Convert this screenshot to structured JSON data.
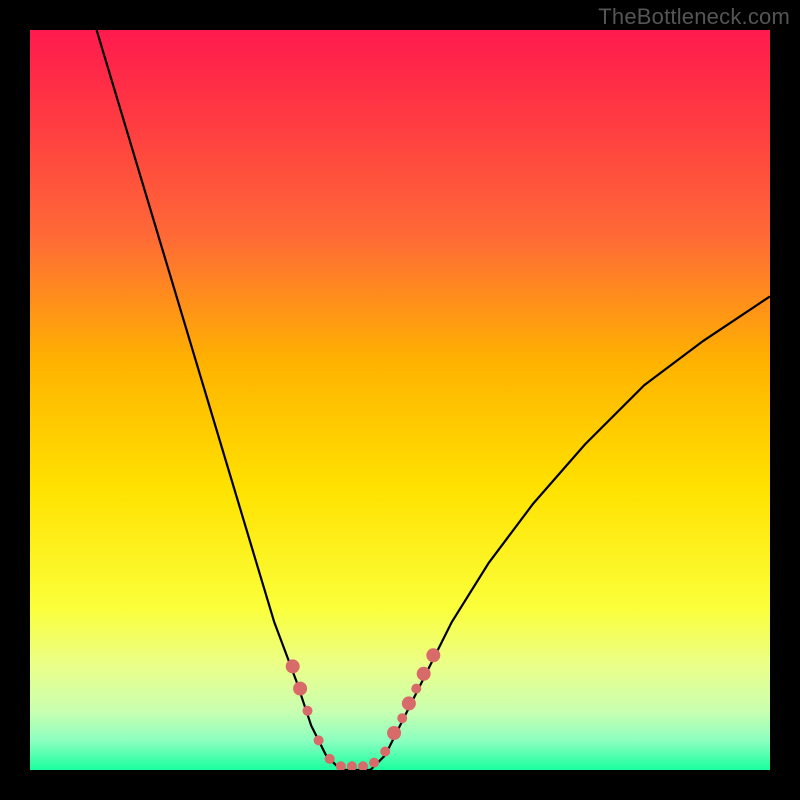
{
  "watermark": "TheBottleneck.com",
  "chart_data": {
    "type": "line",
    "title": "",
    "xlabel": "",
    "ylabel": "",
    "xlim": [
      0,
      100
    ],
    "ylim": [
      0,
      100
    ],
    "background_gradient": {
      "stops": [
        {
          "t": 0.0,
          "color": "#ff1a4d"
        },
        {
          "t": 0.12,
          "color": "#ff3a42"
        },
        {
          "t": 0.28,
          "color": "#ff6a36"
        },
        {
          "t": 0.45,
          "color": "#ffb300"
        },
        {
          "t": 0.62,
          "color": "#ffe200"
        },
        {
          "t": 0.78,
          "color": "#fbff3a"
        },
        {
          "t": 0.86,
          "color": "#eaff8a"
        },
        {
          "t": 0.92,
          "color": "#c9ffb0"
        },
        {
          "t": 0.96,
          "color": "#8dffc0"
        },
        {
          "t": 1.0,
          "color": "#19ff9e"
        }
      ]
    },
    "series": [
      {
        "name": "curve",
        "color": "#000000",
        "points": [
          {
            "x": 9,
            "y": 100
          },
          {
            "x": 12,
            "y": 90
          },
          {
            "x": 15,
            "y": 80
          },
          {
            "x": 18,
            "y": 70
          },
          {
            "x": 21,
            "y": 60
          },
          {
            "x": 24,
            "y": 50
          },
          {
            "x": 27,
            "y": 40
          },
          {
            "x": 30,
            "y": 30
          },
          {
            "x": 33,
            "y": 20
          },
          {
            "x": 36,
            "y": 12
          },
          {
            "x": 38,
            "y": 6
          },
          {
            "x": 40,
            "y": 2
          },
          {
            "x": 42,
            "y": 0
          },
          {
            "x": 44,
            "y": 0
          },
          {
            "x": 46,
            "y": 0
          },
          {
            "x": 48,
            "y": 2
          },
          {
            "x": 50,
            "y": 6
          },
          {
            "x": 53,
            "y": 12
          },
          {
            "x": 57,
            "y": 20
          },
          {
            "x": 62,
            "y": 28
          },
          {
            "x": 68,
            "y": 36
          },
          {
            "x": 75,
            "y": 44
          },
          {
            "x": 83,
            "y": 52
          },
          {
            "x": 91,
            "y": 58
          },
          {
            "x": 100,
            "y": 64
          }
        ]
      }
    ],
    "markers": {
      "color": "#d86a6a",
      "radius_large": 7,
      "radius_small": 5,
      "points": [
        {
          "x": 35.5,
          "y": 14,
          "r": "large"
        },
        {
          "x": 36.5,
          "y": 11,
          "r": "large"
        },
        {
          "x": 37.5,
          "y": 8,
          "r": "small"
        },
        {
          "x": 39,
          "y": 4,
          "r": "small"
        },
        {
          "x": 40.5,
          "y": 1.5,
          "r": "small"
        },
        {
          "x": 42,
          "y": 0.5,
          "r": "small"
        },
        {
          "x": 43.5,
          "y": 0.5,
          "r": "small"
        },
        {
          "x": 45,
          "y": 0.5,
          "r": "small"
        },
        {
          "x": 46.5,
          "y": 1,
          "r": "small"
        },
        {
          "x": 48,
          "y": 2.5,
          "r": "small"
        },
        {
          "x": 49.2,
          "y": 5,
          "r": "large"
        },
        {
          "x": 50.3,
          "y": 7,
          "r": "small"
        },
        {
          "x": 51.2,
          "y": 9,
          "r": "large"
        },
        {
          "x": 52.2,
          "y": 11,
          "r": "small"
        },
        {
          "x": 53.2,
          "y": 13,
          "r": "large"
        },
        {
          "x": 54.5,
          "y": 15.5,
          "r": "large"
        }
      ]
    }
  }
}
